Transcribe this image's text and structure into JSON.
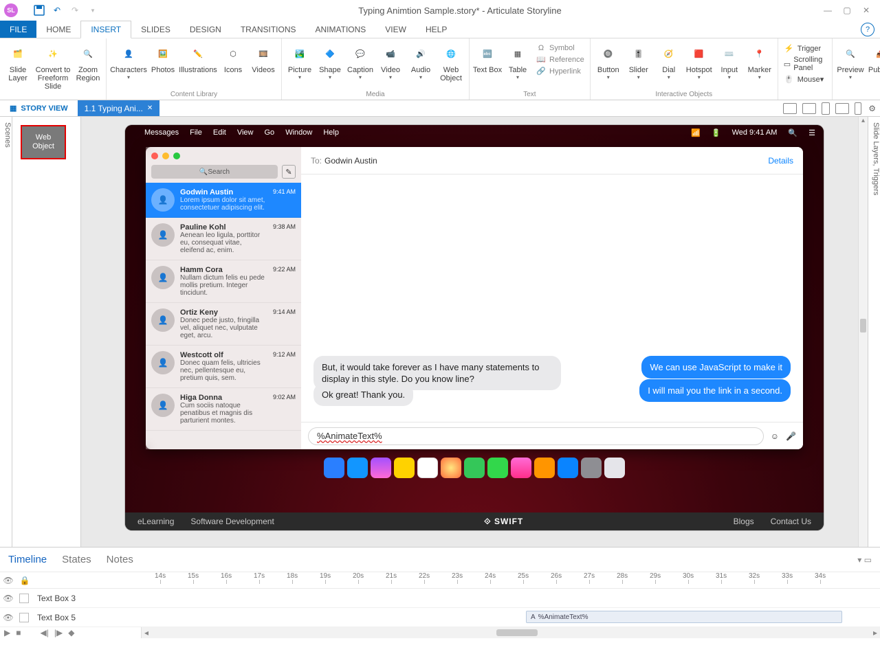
{
  "titlebar": {
    "badge": "SL",
    "title": "Typing Animtion Sample.story* - Articulate Storyline"
  },
  "menu": {
    "file": "FILE",
    "tabs": [
      "HOME",
      "INSERT",
      "SLIDES",
      "DESIGN",
      "TRANSITIONS",
      "ANIMATIONS",
      "VIEW",
      "HELP"
    ],
    "active": "INSERT"
  },
  "ribbon": {
    "slide": [
      "Slide Layer",
      "Convert to Freeform Slide",
      "Zoom Region"
    ],
    "content": {
      "items": [
        "Characters",
        "Photos",
        "Illustrations",
        "Icons",
        "Videos"
      ],
      "label": "Content Library"
    },
    "media": {
      "items": [
        "Picture",
        "Shape",
        "Caption",
        "Video",
        "Audio",
        "Web Object"
      ],
      "label": "Media"
    },
    "text": {
      "items": [
        "Text Box",
        "Table"
      ],
      "small": [
        "Symbol",
        "Reference",
        "Hyperlink"
      ],
      "label": "Text"
    },
    "interactive": {
      "items": [
        "Button",
        "Slider",
        "Dial",
        "Hotspot",
        "Input",
        "Marker"
      ],
      "label": "Interactive Objects"
    },
    "links": {
      "items": [
        "Trigger",
        "Scrolling Panel",
        "Mouse"
      ]
    },
    "publish": [
      "Preview",
      "Publish"
    ]
  },
  "doctabs": {
    "story_view": "STORY VIEW",
    "tab": "1.1 Typing Ani..."
  },
  "rails": {
    "left": "Scenes",
    "right": "Slide Layers, Triggers"
  },
  "scene_thumb": {
    "l1": "Web",
    "l2": "Object"
  },
  "mac": {
    "menu": [
      "Messages",
      "File",
      "Edit",
      "View",
      "Go",
      "Window",
      "Help"
    ],
    "clock": "Wed 9:41 AM",
    "search": "Search",
    "to_label": "To:",
    "to_name": "Godwin Austin",
    "details": "Details",
    "conversations": [
      {
        "name": "Godwin Austin",
        "preview": "Lorem ipsum dolor sit amet, consectetuer adipiscing elit.",
        "time": "9:41 AM",
        "active": true
      },
      {
        "name": "Pauline Kohl",
        "preview": "Aenean leo ligula, porttitor eu, consequat vitae, eleifend ac, enim.",
        "time": "9:38 AM"
      },
      {
        "name": "Hamm Cora",
        "preview": "Nullam dictum felis eu pede mollis pretium. Integer tincidunt.",
        "time": "9:22 AM"
      },
      {
        "name": "Ortiz Keny",
        "preview": "Donec pede justo, fringilla vel, aliquet nec, vulputate eget, arcu.",
        "time": "9:14 AM"
      },
      {
        "name": "Westcott olf",
        "preview": "Donec quam felis, ultricies nec, pellentesque eu, pretium quis, sem.",
        "time": "9:12 AM"
      },
      {
        "name": "Higa Donna",
        "preview": "Cum sociis natoque penatibus et magnis dis parturient montes.",
        "time": "9:02 AM"
      }
    ],
    "grey1": "But, it would take forever as I have many statements to display in this style. Do you know               line?",
    "grey2": "Ok great! Thank you.",
    "blue1": "We can use JavaScript to make it",
    "blue2": "I will mail you the link in a second.",
    "input": "%AnimateText%"
  },
  "slide_footer": {
    "left1": "eLearning",
    "left2": "Software Development",
    "brand": "SWIFT",
    "r1": "Blogs",
    "r2": "Contact Us"
  },
  "bottom": {
    "tabs": [
      "Timeline",
      "States",
      "Notes"
    ],
    "active": "Timeline",
    "ticks": [
      "14s",
      "15s",
      "16s",
      "17s",
      "18s",
      "19s",
      "20s",
      "21s",
      "22s",
      "23s",
      "24s",
      "25s",
      "26s",
      "27s",
      "28s",
      "29s",
      "30s",
      "31s",
      "32s",
      "33s",
      "34s"
    ],
    "rows": [
      {
        "name": "Text Box 3"
      },
      {
        "name": "Text Box 5",
        "obj": "%AnimateText%"
      }
    ]
  }
}
